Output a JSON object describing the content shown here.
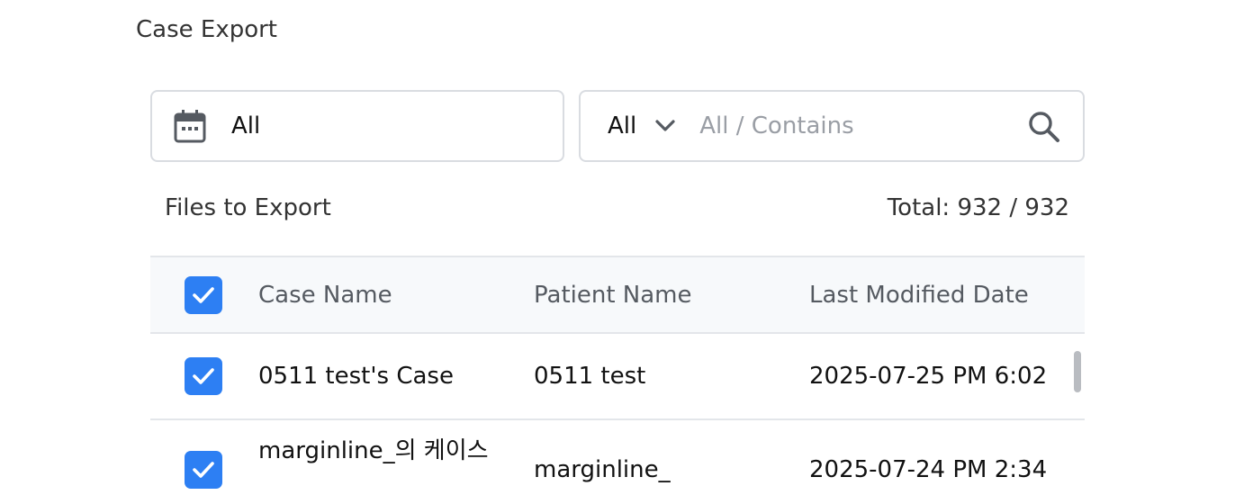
{
  "header": {
    "title": "Case Export"
  },
  "date_filter": {
    "value": "All",
    "icon": "calendar-icon"
  },
  "search": {
    "scope_value": "All",
    "placeholder": "All / Contains",
    "value": "",
    "icons": {
      "dropdown": "chevron-down-icon",
      "search": "search-icon"
    }
  },
  "files": {
    "title": "Files to Export",
    "total_text": "Total: 932 / 932"
  },
  "table": {
    "columns": [
      "Case Name",
      "Patient Name",
      "Last Modified Date"
    ],
    "rows": [
      {
        "case_name": "0511 test's Case",
        "patient_name": "0511 test",
        "modified": "2025-07-25 PM 6:02",
        "checked": true
      },
      {
        "case_name": "marginline_의 케이스",
        "patient_name": "marginline_",
        "modified": "2025-07-24 PM 2:34",
        "checked": true
      }
    ]
  },
  "colors": {
    "accent": "#2d7ff3",
    "border": "#d9dce1",
    "header_bg": "#f7f9fb"
  }
}
